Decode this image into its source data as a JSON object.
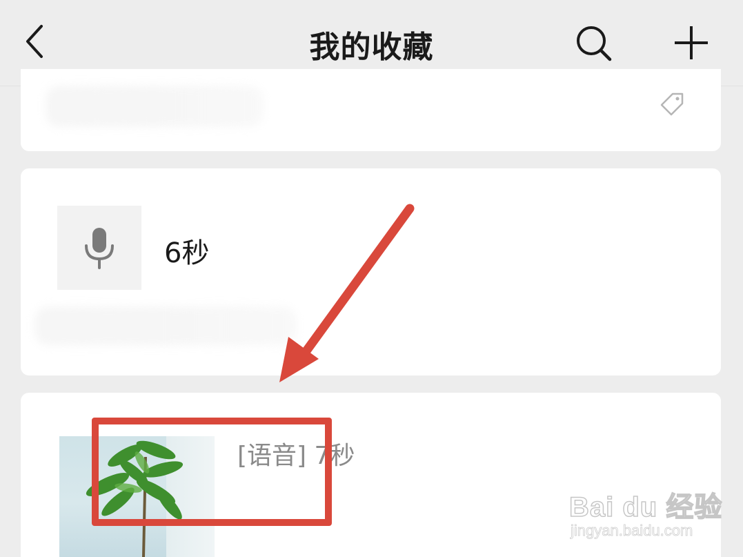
{
  "header": {
    "title": "我的收藏",
    "back_icon": "chevron-left-icon",
    "search_icon": "search-icon",
    "add_icon": "plus-icon"
  },
  "items": [
    {
      "type": "blurred",
      "tag_icon": "tag-icon"
    },
    {
      "type": "voice",
      "icon": "microphone-icon",
      "duration": "6秒"
    },
    {
      "type": "image",
      "text": "[语音] 7秒"
    }
  ],
  "annotation": {
    "color": "#d9483b"
  },
  "watermark": {
    "brand": "Bai du 经验",
    "url": "jingyan.baidu.com"
  }
}
